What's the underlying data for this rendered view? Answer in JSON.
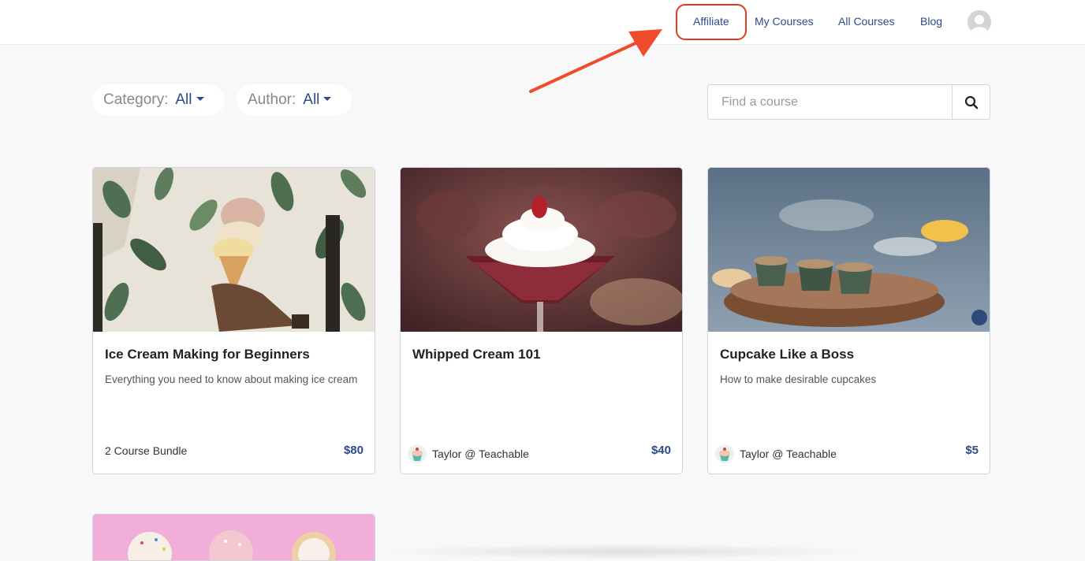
{
  "nav": {
    "links": [
      "Affiliate",
      "My Courses",
      "All Courses",
      "Blog"
    ]
  },
  "filters": {
    "category_label": "Category:",
    "category_value": "All",
    "author_label": "Author:",
    "author_value": "All"
  },
  "search": {
    "placeholder": "Find a course"
  },
  "courses": [
    {
      "title": "Ice Cream Making for Beginners",
      "description": "Everything you need to know about making ice cream",
      "footer_text": "2 Course Bundle",
      "price": "$80",
      "has_author_avatar": false
    },
    {
      "title": "Whipped Cream 101",
      "description": "",
      "footer_text": "Taylor @ Teachable",
      "price": "$40",
      "has_author_avatar": true
    },
    {
      "title": "Cupcake Like a Boss",
      "description": "How to make desirable cupcakes",
      "footer_text": "Taylor @ Teachable",
      "price": "$5",
      "has_author_avatar": true
    }
  ],
  "colors": {
    "accent": "#2d4a8a",
    "annotation": "#e03a1e"
  },
  "icons": {
    "search": "search-icon",
    "user": "user-avatar-icon",
    "caret": "caret-down-icon"
  }
}
